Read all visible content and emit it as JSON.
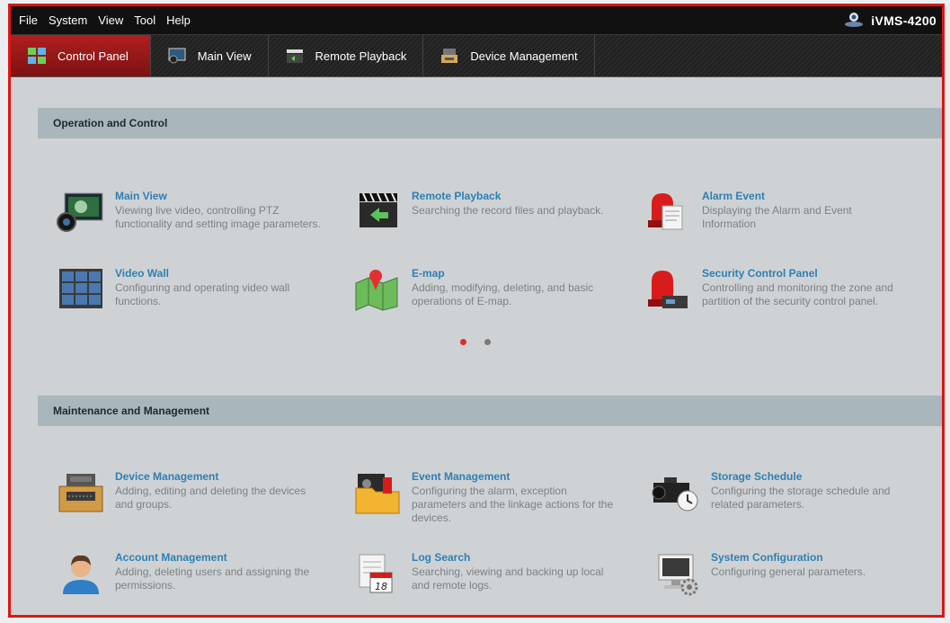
{
  "menu": [
    "File",
    "System",
    "View",
    "Tool",
    "Help"
  ],
  "brand": {
    "title": "iVMS-4200"
  },
  "tabs": [
    {
      "label": "Control Panel",
      "icon": "control-panel-icon",
      "active": true
    },
    {
      "label": "Main View",
      "icon": "main-view-icon",
      "active": false
    },
    {
      "label": "Remote Playback",
      "icon": "remote-playback-icon",
      "active": false
    },
    {
      "label": "Device Management",
      "icon": "device-management-icon",
      "active": false
    }
  ],
  "sections": {
    "operation": {
      "title": "Operation and Control",
      "items": [
        {
          "title": "Main View",
          "desc": "Viewing live video, controlling PTZ functionality and setting image parameters.",
          "icon": "camera-lens-icon"
        },
        {
          "title": "Remote Playback",
          "desc": "Searching the record files and playback.",
          "icon": "clapper-playback-icon"
        },
        {
          "title": "Alarm Event",
          "desc": "Displaying the Alarm and Event Information",
          "icon": "alarm-light-icon"
        },
        {
          "title": "Video Wall",
          "desc": "Configuring and operating video wall functions.",
          "icon": "video-wall-icon"
        },
        {
          "title": "E-map",
          "desc": "Adding, modifying, deleting, and basic operations of E-map.",
          "icon": "map-pin-icon"
        },
        {
          "title": "Security Control Panel",
          "desc": "Controlling and monitoring the zone and partition of the security control panel.",
          "icon": "security-alarm-icon"
        }
      ]
    },
    "maintenance": {
      "title": "Maintenance and Management",
      "items": [
        {
          "title": "Device Management",
          "desc": "Adding, editing and deleting the devices and groups.",
          "icon": "dvr-device-icon"
        },
        {
          "title": "Event Management",
          "desc": "Configuring the alarm, exception parameters and the linkage actions for the devices.",
          "icon": "event-folder-icon"
        },
        {
          "title": "Storage Schedule",
          "desc": "Configuring the storage schedule and related parameters.",
          "icon": "camera-clock-icon"
        },
        {
          "title": "Account Management",
          "desc": "Adding, deleting users and assigning the permissions.",
          "icon": "user-account-icon"
        },
        {
          "title": "Log Search",
          "desc": "Searching, viewing and backing up local and remote logs.",
          "icon": "calendar-log-icon"
        },
        {
          "title": "System Configuration",
          "desc": "Configuring general parameters.",
          "icon": "monitor-gear-icon"
        }
      ]
    }
  },
  "pager": {
    "pages": 2,
    "current": 1
  }
}
